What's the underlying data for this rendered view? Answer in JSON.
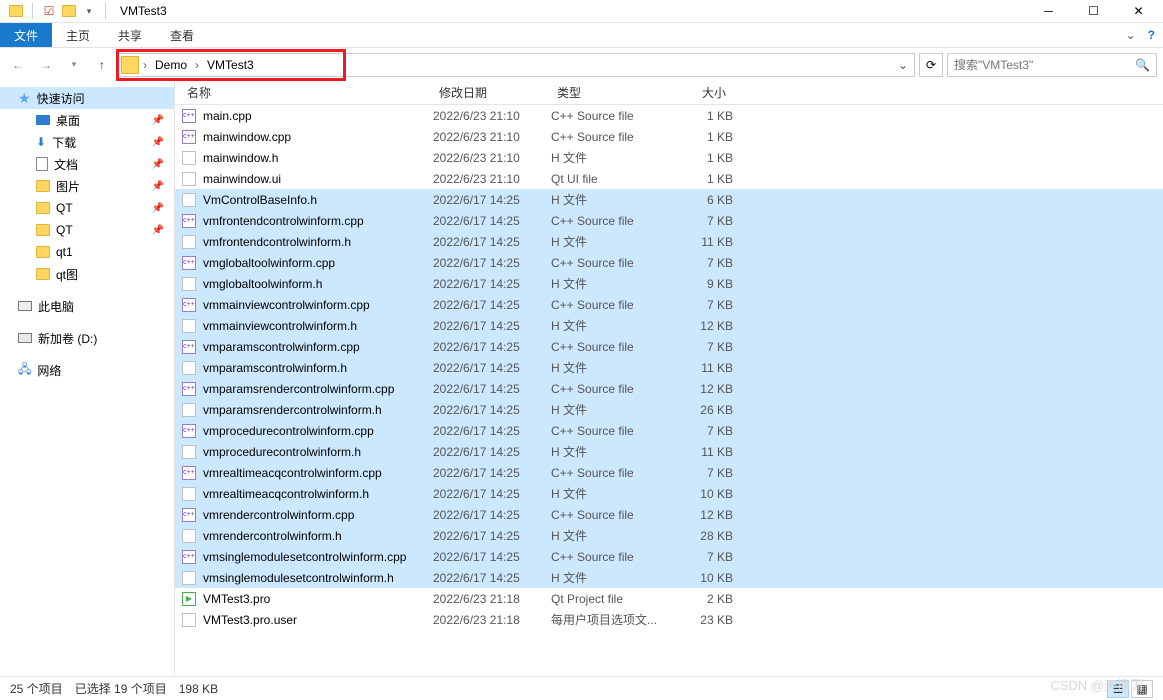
{
  "window": {
    "title": "VMTest3"
  },
  "ribbon": {
    "file": "文件",
    "tabs": [
      "主页",
      "共享",
      "查看"
    ]
  },
  "breadcrumb": {
    "items": [
      "Demo",
      "VMTest3"
    ]
  },
  "search": {
    "placeholder": "搜索\"VMTest3\""
  },
  "sidebar": {
    "quick": "快速访问",
    "desktop": "桌面",
    "downloads": "下载",
    "documents": "文档",
    "pictures": "图片",
    "qt_a": "QT",
    "qt_b": "QT",
    "qt1": "qt1",
    "qtimg": "qt图",
    "thispc": "此电脑",
    "drive": "新加卷 (D:)",
    "network": "网络"
  },
  "columns": {
    "name": "名称",
    "date": "修改日期",
    "type": "类型",
    "size": "大小"
  },
  "files": [
    {
      "icon": "cpp",
      "name": "main.cpp",
      "date": "2022/6/23 21:10",
      "type": "C++ Source file",
      "size": "1 KB",
      "sel": false
    },
    {
      "icon": "cpp",
      "name": "mainwindow.cpp",
      "date": "2022/6/23 21:10",
      "type": "C++ Source file",
      "size": "1 KB",
      "sel": false
    },
    {
      "icon": "h",
      "name": "mainwindow.h",
      "date": "2022/6/23 21:10",
      "type": "H 文件",
      "size": "1 KB",
      "sel": false
    },
    {
      "icon": "ui",
      "name": "mainwindow.ui",
      "date": "2022/6/23 21:10",
      "type": "Qt UI file",
      "size": "1 KB",
      "sel": false
    },
    {
      "icon": "h",
      "name": "VmControlBaseInfo.h",
      "date": "2022/6/17 14:25",
      "type": "H 文件",
      "size": "6 KB",
      "sel": true
    },
    {
      "icon": "cpp",
      "name": "vmfrontendcontrolwinform.cpp",
      "date": "2022/6/17 14:25",
      "type": "C++ Source file",
      "size": "7 KB",
      "sel": true
    },
    {
      "icon": "h",
      "name": "vmfrontendcontrolwinform.h",
      "date": "2022/6/17 14:25",
      "type": "H 文件",
      "size": "11 KB",
      "sel": true
    },
    {
      "icon": "cpp",
      "name": "vmglobaltoolwinform.cpp",
      "date": "2022/6/17 14:25",
      "type": "C++ Source file",
      "size": "7 KB",
      "sel": true
    },
    {
      "icon": "h",
      "name": "vmglobaltoolwinform.h",
      "date": "2022/6/17 14:25",
      "type": "H 文件",
      "size": "9 KB",
      "sel": true
    },
    {
      "icon": "cpp",
      "name": "vmmainviewcontrolwinform.cpp",
      "date": "2022/6/17 14:25",
      "type": "C++ Source file",
      "size": "7 KB",
      "sel": true
    },
    {
      "icon": "h",
      "name": "vmmainviewcontrolwinform.h",
      "date": "2022/6/17 14:25",
      "type": "H 文件",
      "size": "12 KB",
      "sel": true
    },
    {
      "icon": "cpp",
      "name": "vmparamscontrolwinform.cpp",
      "date": "2022/6/17 14:25",
      "type": "C++ Source file",
      "size": "7 KB",
      "sel": true
    },
    {
      "icon": "h",
      "name": "vmparamscontrolwinform.h",
      "date": "2022/6/17 14:25",
      "type": "H 文件",
      "size": "11 KB",
      "sel": true
    },
    {
      "icon": "cpp",
      "name": "vmparamsrendercontrolwinform.cpp",
      "date": "2022/6/17 14:25",
      "type": "C++ Source file",
      "size": "12 KB",
      "sel": true
    },
    {
      "icon": "h",
      "name": "vmparamsrendercontrolwinform.h",
      "date": "2022/6/17 14:25",
      "type": "H 文件",
      "size": "26 KB",
      "sel": true
    },
    {
      "icon": "cpp",
      "name": "vmprocedurecontrolwinform.cpp",
      "date": "2022/6/17 14:25",
      "type": "C++ Source file",
      "size": "7 KB",
      "sel": true
    },
    {
      "icon": "h",
      "name": "vmprocedurecontrolwinform.h",
      "date": "2022/6/17 14:25",
      "type": "H 文件",
      "size": "11 KB",
      "sel": true
    },
    {
      "icon": "cpp",
      "name": "vmrealtimeacqcontrolwinform.cpp",
      "date": "2022/6/17 14:25",
      "type": "C++ Source file",
      "size": "7 KB",
      "sel": true
    },
    {
      "icon": "h",
      "name": "vmrealtimeacqcontrolwinform.h",
      "date": "2022/6/17 14:25",
      "type": "H 文件",
      "size": "10 KB",
      "sel": true
    },
    {
      "icon": "cpp",
      "name": "vmrendercontrolwinform.cpp",
      "date": "2022/6/17 14:25",
      "type": "C++ Source file",
      "size": "12 KB",
      "sel": true
    },
    {
      "icon": "h",
      "name": "vmrendercontrolwinform.h",
      "date": "2022/6/17 14:25",
      "type": "H 文件",
      "size": "28 KB",
      "sel": true
    },
    {
      "icon": "cpp",
      "name": "vmsinglemodulesetcontrolwinform.cpp",
      "date": "2022/6/17 14:25",
      "type": "C++ Source file",
      "size": "7 KB",
      "sel": true
    },
    {
      "icon": "h",
      "name": "vmsinglemodulesetcontrolwinform.h",
      "date": "2022/6/17 14:25",
      "type": "H 文件",
      "size": "10 KB",
      "sel": true
    },
    {
      "icon": "pro",
      "name": "VMTest3.pro",
      "date": "2022/6/23 21:18",
      "type": "Qt Project file",
      "size": "2 KB",
      "sel": false
    },
    {
      "icon": "user",
      "name": "VMTest3.pro.user",
      "date": "2022/6/23 21:18",
      "type": "每用户项目选项文...",
      "size": "23 KB",
      "sel": false
    }
  ],
  "status": {
    "count": "25 个项目",
    "selection": "已选择 19 个项目",
    "size": "198 KB"
  },
  "watermark": "CSDN @天撸国"
}
